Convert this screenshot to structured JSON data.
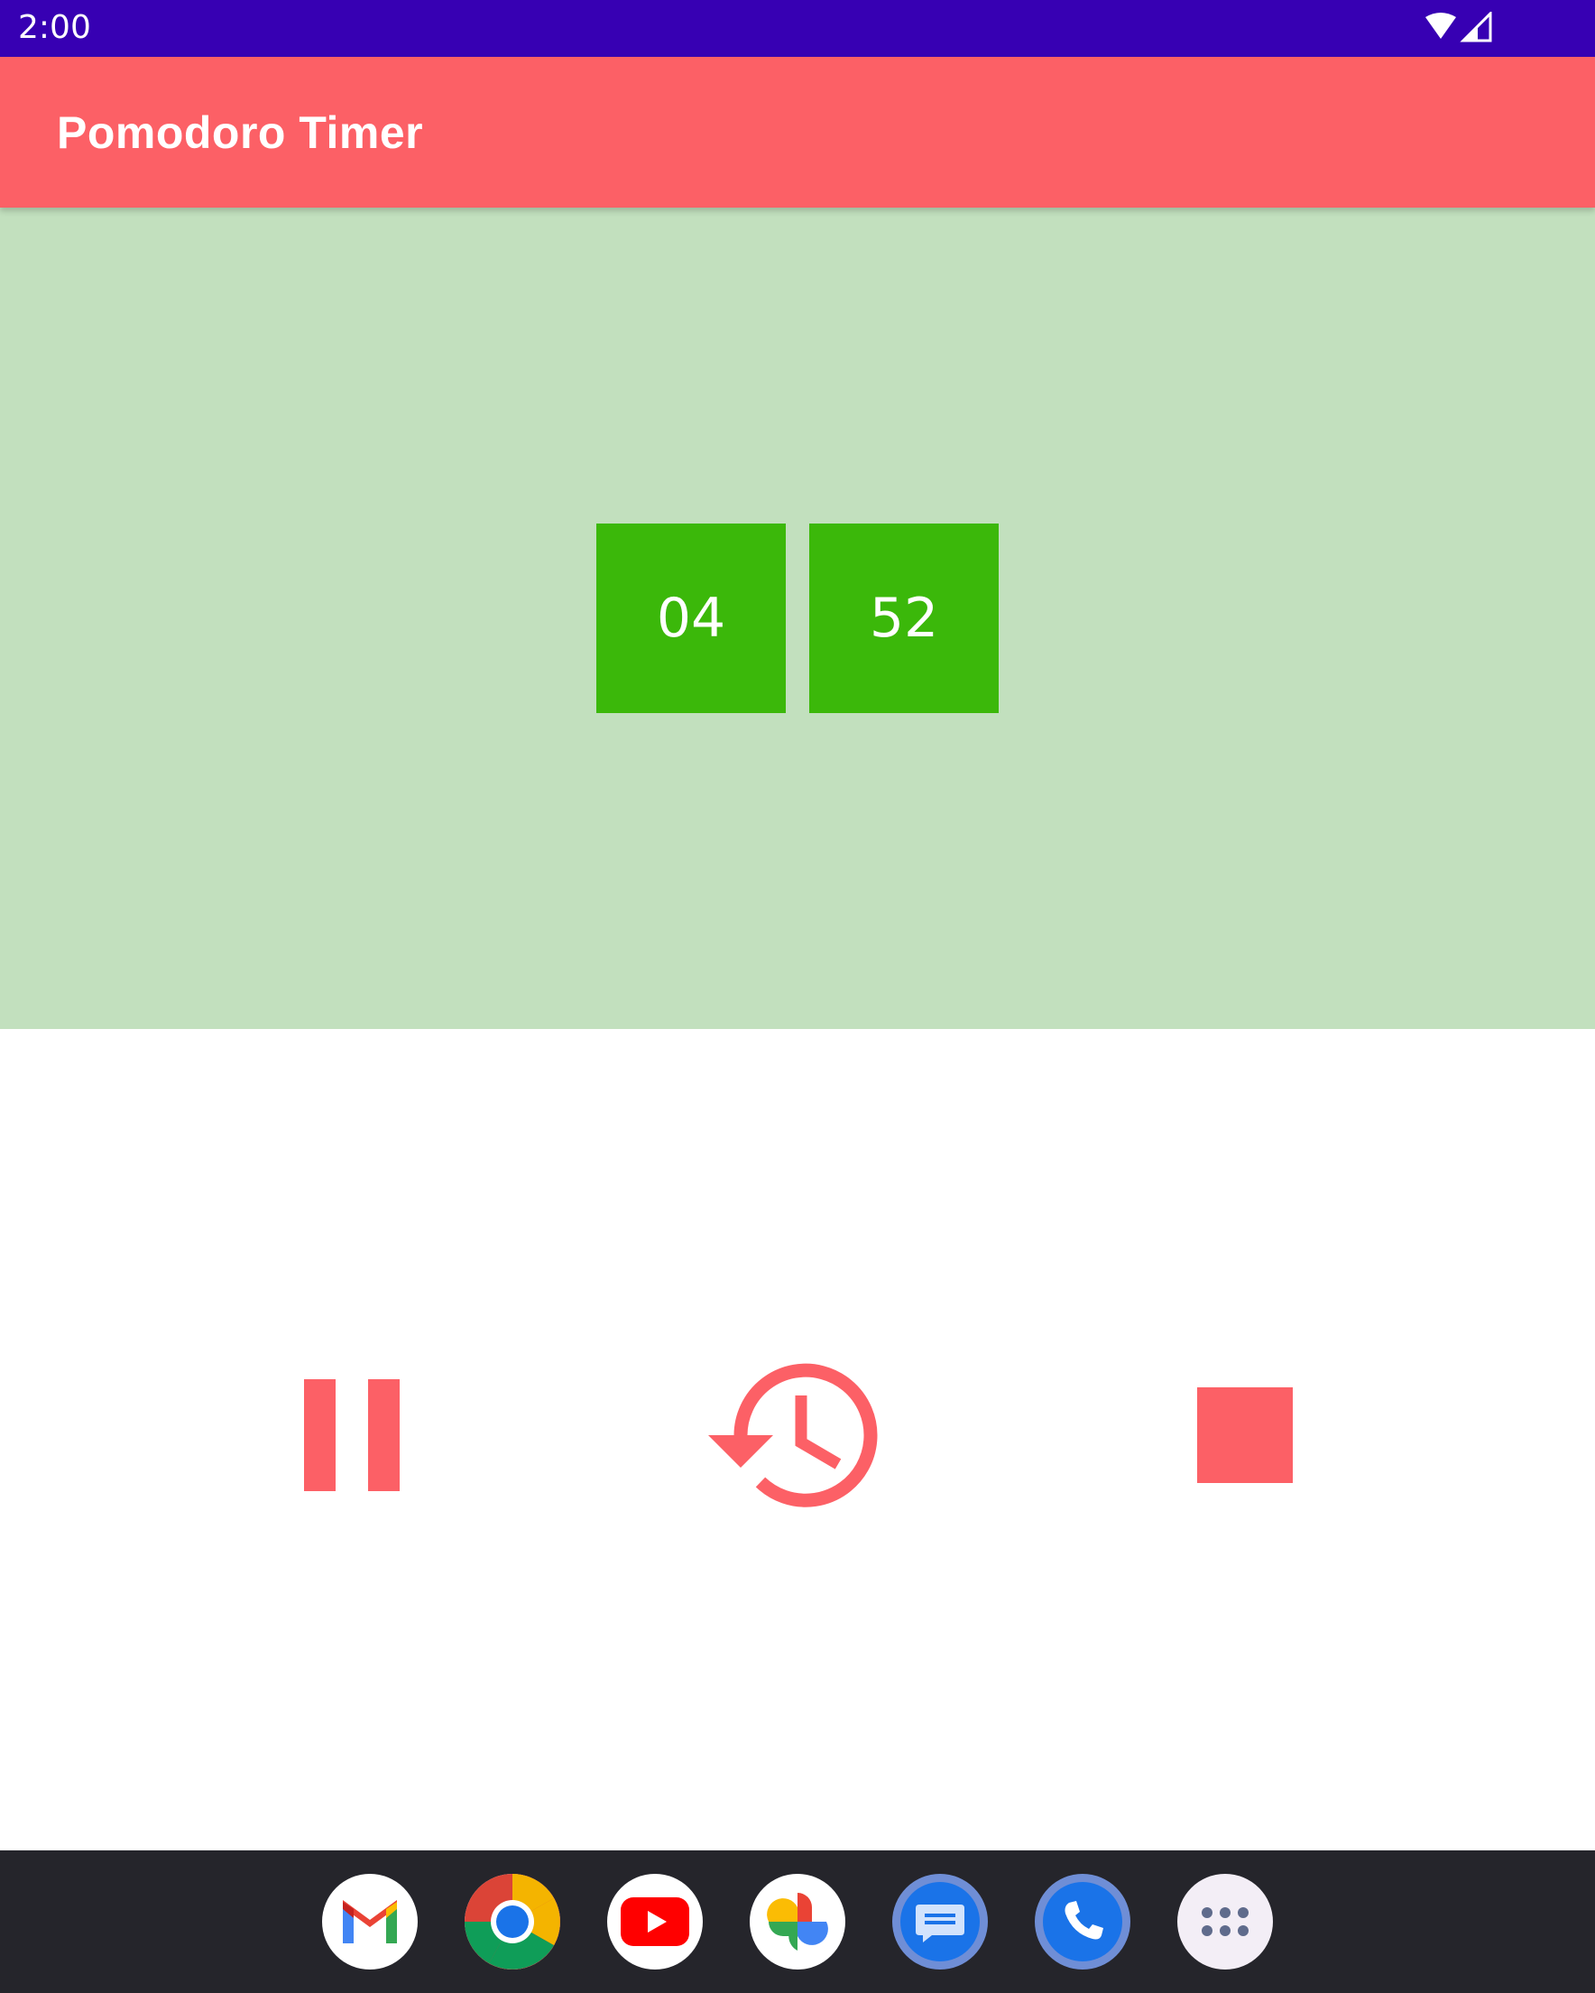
{
  "status_bar": {
    "time": "2:00",
    "icons": [
      "wifi-icon",
      "cell-signal-icon"
    ],
    "bg_color": "#3700b3"
  },
  "app_bar": {
    "title": "Pomodoro Timer",
    "bg_color": "#fc6066"
  },
  "timer": {
    "minutes": "04",
    "seconds": "52",
    "panel_color": "#c2e0be",
    "box_color": "#3bb80a"
  },
  "controls": {
    "buttons": [
      {
        "name": "pause",
        "icon": "pause-icon"
      },
      {
        "name": "restart",
        "icon": "history-icon"
      },
      {
        "name": "stop",
        "icon": "stop-icon"
      }
    ],
    "icon_color": "#fc6066"
  },
  "dock": {
    "apps": [
      {
        "name": "gmail",
        "icon": "gmail-icon"
      },
      {
        "name": "chrome",
        "icon": "chrome-icon"
      },
      {
        "name": "youtube",
        "icon": "youtube-icon"
      },
      {
        "name": "photos",
        "icon": "photos-icon"
      },
      {
        "name": "messages",
        "icon": "messages-icon"
      },
      {
        "name": "phone",
        "icon": "phone-icon"
      },
      {
        "name": "app-drawer",
        "icon": "app-drawer-icon"
      }
    ],
    "bg_color": "#25252b"
  }
}
